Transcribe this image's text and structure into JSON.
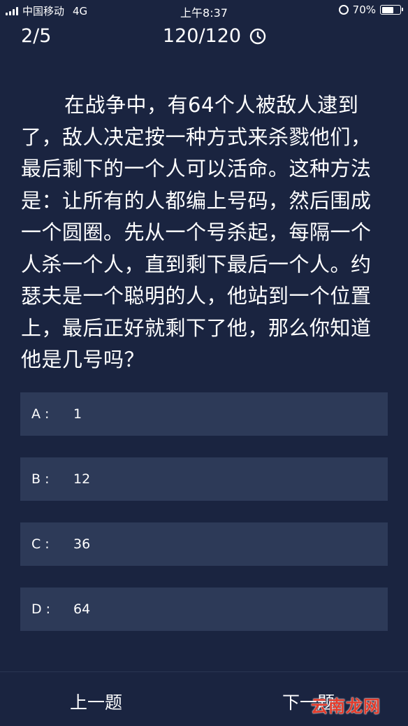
{
  "status_bar": {
    "carrier": "中国移动",
    "network": "4G",
    "time": "上午8:37",
    "battery": "70%",
    "battery_level": 0.7
  },
  "header": {
    "progress": "2/5",
    "timer": "120/120"
  },
  "question": {
    "text": "在战争中，有64个人被敌人逮到了，敌人决定按一种方式来杀戮他们，最后剩下的一个人可以活命。这种方法是：让所有的人都编上号码，然后围成一个圆圈。先从一个号杀起，每隔一个人杀一个人，直到剩下最后一个人。约瑟夫是一个聪明的人，他站到一个位置上，最后正好就剩下了他，那么你知道他是几号吗？"
  },
  "options": [
    {
      "letter": "A :",
      "value": "1"
    },
    {
      "letter": "B :",
      "value": "12"
    },
    {
      "letter": "C :",
      "value": "36"
    },
    {
      "letter": "D :",
      "value": "64"
    }
  ],
  "footer": {
    "prev_label": "上一题",
    "next_label": "下一题"
  },
  "watermark": "云南龙网"
}
